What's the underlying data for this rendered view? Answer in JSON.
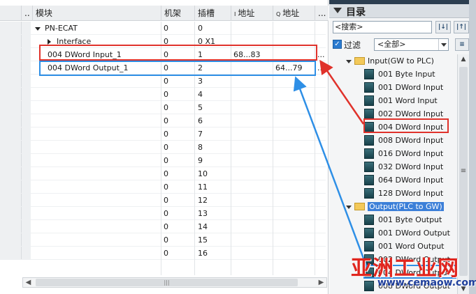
{
  "table": {
    "headers": {
      "gutter": "..",
      "module": "模块",
      "rack": "机架",
      "slot": "插槽",
      "i_prefix": "I",
      "i_addr": "地址",
      "q_prefix": "Q",
      "q_addr": "地址",
      "more": "..."
    },
    "rows": [
      {
        "module": "PN-ECAT",
        "rack": "0",
        "slot": "0",
        "i_addr": "",
        "q_addr": ""
      },
      {
        "module": "Interface",
        "rack": "0",
        "slot": "0 X1",
        "i_addr": "",
        "q_addr": ""
      },
      {
        "module": "004 DWord Input_1",
        "rack": "0",
        "slot": "1",
        "i_addr": "68...83",
        "q_addr": ""
      },
      {
        "module": "004 DWord Output_1",
        "rack": "0",
        "slot": "2",
        "i_addr": "",
        "q_addr": "64...79"
      },
      {
        "module": "",
        "rack": "0",
        "slot": "3",
        "i_addr": "",
        "q_addr": ""
      },
      {
        "module": "",
        "rack": "0",
        "slot": "4",
        "i_addr": "",
        "q_addr": ""
      },
      {
        "module": "",
        "rack": "0",
        "slot": "5",
        "i_addr": "",
        "q_addr": ""
      },
      {
        "module": "",
        "rack": "0",
        "slot": "6",
        "i_addr": "",
        "q_addr": ""
      },
      {
        "module": "",
        "rack": "0",
        "slot": "7",
        "i_addr": "",
        "q_addr": ""
      },
      {
        "module": "",
        "rack": "0",
        "slot": "8",
        "i_addr": "",
        "q_addr": ""
      },
      {
        "module": "",
        "rack": "0",
        "slot": "9",
        "i_addr": "",
        "q_addr": ""
      },
      {
        "module": "",
        "rack": "0",
        "slot": "10",
        "i_addr": "",
        "q_addr": ""
      },
      {
        "module": "",
        "rack": "0",
        "slot": "11",
        "i_addr": "",
        "q_addr": ""
      },
      {
        "module": "",
        "rack": "0",
        "slot": "12",
        "i_addr": "",
        "q_addr": ""
      },
      {
        "module": "",
        "rack": "0",
        "slot": "13",
        "i_addr": "",
        "q_addr": ""
      },
      {
        "module": "",
        "rack": "0",
        "slot": "14",
        "i_addr": "",
        "q_addr": ""
      },
      {
        "module": "",
        "rack": "0",
        "slot": "15",
        "i_addr": "",
        "q_addr": ""
      },
      {
        "module": "",
        "rack": "0",
        "slot": "16",
        "i_addr": "",
        "q_addr": ""
      }
    ],
    "row_more": [
      "",
      "",
      "...",
      "...",
      "",
      "",
      "",
      "",
      "",
      "",
      "",
      "",
      "",
      "",
      "",
      "",
      "",
      ""
    ],
    "scrollbar": {
      "left": "◀",
      "thumb_grip": "|||",
      "right": "▶"
    }
  },
  "catalog": {
    "title": "目录",
    "search_placeholder": "<搜索>",
    "search_btn_1": "|↓|",
    "search_btn_2": "|↑|",
    "filter_label": "过滤",
    "filter_value": "<全部>",
    "filter_btn": "≡",
    "input_folder": "Input(GW to PLC)",
    "input_items": [
      "001 Byte Input",
      "001 DWord Input",
      "001 Word Input",
      "002 DWord Input",
      "004 DWord Input",
      "008 DWord Input",
      "016 DWord Input",
      "032 DWord Input",
      "064 DWord Input",
      "128 DWord Input"
    ],
    "output_folder": "Output(PLC to GW)",
    "output_items": [
      "001 Byte Output",
      "001 DWord Output",
      "001 Word Output",
      "002 DWord Output",
      "004 DWord Output",
      "008 DWord Output"
    ],
    "vscroll": {
      "up": "▲",
      "grip": "≡",
      "down": "▼"
    }
  },
  "watermark": {
    "cn": "亚洲工业网",
    "en": "www.cemaow.com"
  },
  "colors": {
    "red_highlight": "#e0322b",
    "blue_highlight": "#2e8fe6",
    "selected": "#3c7fd8"
  }
}
